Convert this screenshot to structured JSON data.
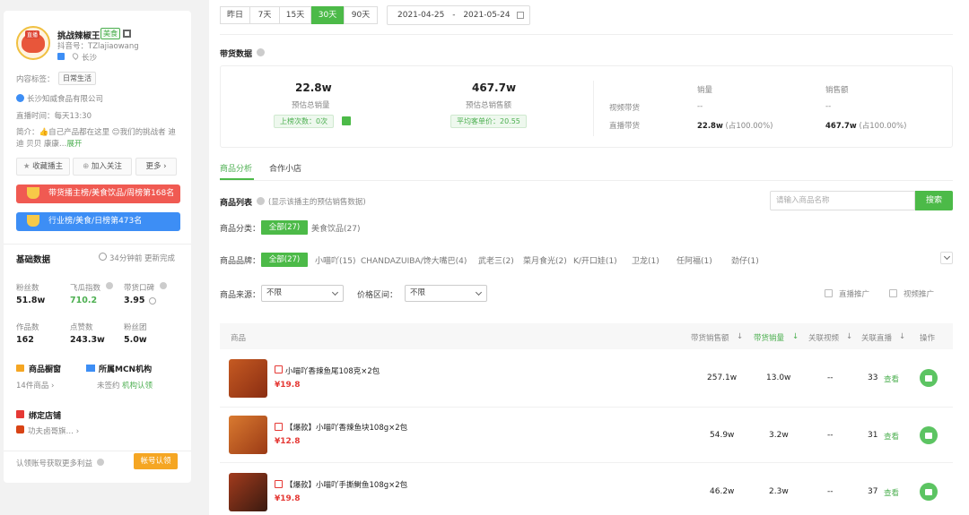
{
  "profile": {
    "name": "挑战辣椒王",
    "category_badge": "美食",
    "douyin_id": "抖音号：TZlajiaowang",
    "location": "长沙",
    "avatar_text": "直播",
    "content_tag_label": "内容标签：",
    "content_tag": "日常生活",
    "company": "长沙知威食品有限公司",
    "live_time": "直播时间：每天13:30",
    "intro": "简介：👍自己产品都在这里 😊我们的挑战者 迪迪 贝贝 康康…",
    "expand": "展开",
    "follow_streamer": "收藏播主",
    "add_attention": "加入关注",
    "more": "更多"
  },
  "rankings": [
    {
      "text": "带货播主榜/美食饮品/周榜第168名",
      "color": "#f05a52"
    },
    {
      "text": "行业榜/美食/日榜第473名",
      "color": "#3d8ef5"
    }
  ],
  "basic": {
    "title": "基础数据",
    "update": "34分钟前 更新完成",
    "stats": [
      {
        "label": "粉丝数",
        "value": "51.8w"
      },
      {
        "label": "飞瓜指数",
        "value": "710.2",
        "green": true
      },
      {
        "label": "带货口碑",
        "value": "3.95"
      },
      {
        "label": "作品数",
        "value": "162"
      },
      {
        "label": "点赞数",
        "value": "243.3w"
      },
      {
        "label": "粉丝团",
        "value": "5.0w"
      }
    ],
    "window_title": "商品橱窗",
    "window_value": "14件商品",
    "mcn_title": "所属MCN机构",
    "mcn_value": "未签约",
    "mcn_link": "机构认领",
    "store_title": "绑定店铺",
    "store_value": "功夫卤哥旗…",
    "claim_text": "认领账号获取更多利益",
    "claim_button": "帐号认领"
  },
  "date_tabs": [
    "昨日",
    "7天",
    "15天",
    "30天",
    "90天"
  ],
  "date_active": "30天",
  "date_start": "2021-04-25",
  "date_sep": "-",
  "date_end": "2021-05-24",
  "sales": {
    "title": "带货数据",
    "total_sales": "22.8w",
    "total_sales_label": "预估总销量",
    "chart_count": "上榜次数：0次",
    "total_amount": "467.7w",
    "total_amount_label": "预估总销售额",
    "avg_price": "平均客单价：20.55",
    "col_sales": "销量",
    "col_amount": "销售额",
    "row1_label": "视频带货",
    "row1_sales": "--",
    "row1_amount": "--",
    "row2_label": "直播带货",
    "row2_sales": "22.8w",
    "row2_sales_pct": "(占100.00%)",
    "row2_amount": "467.7w",
    "row2_amount_pct": "(占100.00%)"
  },
  "subtabs": [
    "商品分析",
    "合作小店"
  ],
  "list": {
    "title": "商品列表",
    "hint": "(显示该播主的预估销售数据)",
    "search_placeholder": "请输入商品名称",
    "search_button": "搜索",
    "category_label": "商品分类：",
    "category_all": "全部(27)",
    "category_items": [
      "美食饮品(27)"
    ],
    "brand_label": "商品品牌：",
    "brand_all": "全部(27)",
    "brands": [
      "小喵吖(15)",
      "CHANDAZUIBA/馋大嘴巴(4)",
      "武老三(2)",
      "菜月食光(2)",
      "K/开口娃(1)",
      "卫龙(1)",
      "任阿福(1)",
      "劲仔(1)"
    ],
    "source_label": "商品来源：",
    "source_value": "不限",
    "price_label": "价格区间：",
    "price_value": "不限",
    "live_promo": "直播推广",
    "video_promo": "视频推广"
  },
  "table": {
    "headers": [
      "商品",
      "带货销售额",
      "带货销量",
      "关联视频",
      "关联直播",
      "操作"
    ],
    "rows": [
      {
        "title": "小喵吖香辣鱼尾108克×2包",
        "price": "¥19.8",
        "revenue": "257.1w",
        "sales": "13.0w",
        "videos": "--",
        "lives": "33",
        "view": "查看"
      },
      {
        "title": "【爆款】小喵吖香辣鱼块108g×2包",
        "price": "¥12.8",
        "revenue": "54.9w",
        "sales": "3.2w",
        "videos": "--",
        "lives": "31",
        "view": "查看"
      },
      {
        "title": "【爆款】小喵吖手撕鲥鱼108g×2包",
        "price": "¥19.8",
        "revenue": "46.2w",
        "sales": "2.3w",
        "videos": "--",
        "lives": "37",
        "view": "查看"
      }
    ]
  }
}
